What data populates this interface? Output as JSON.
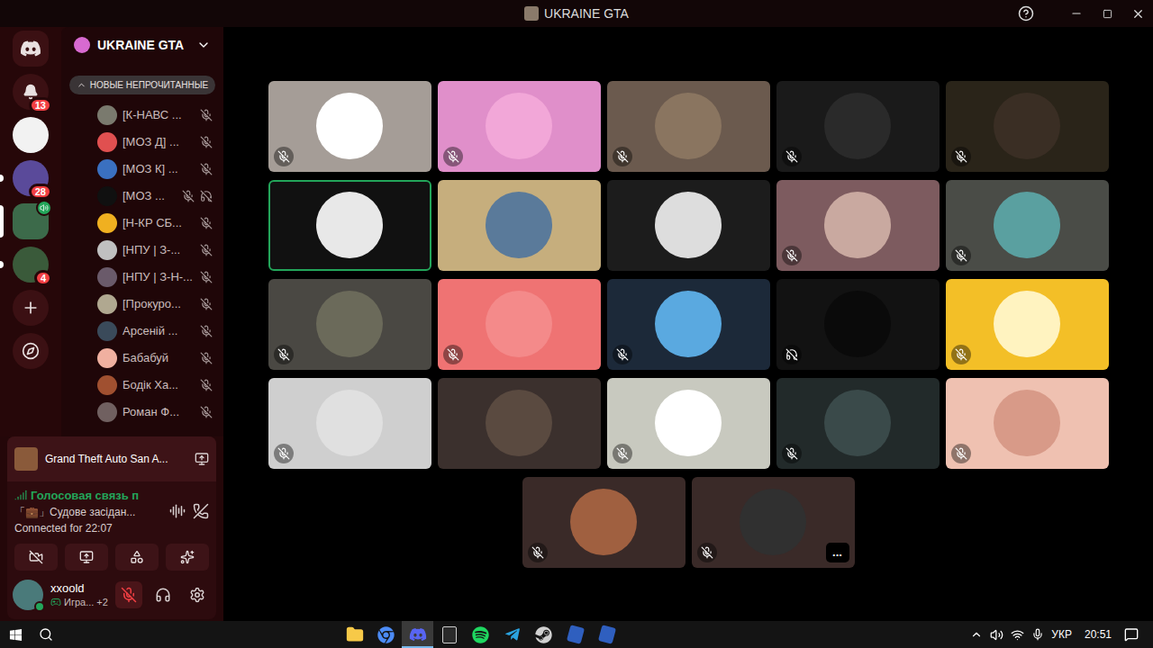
{
  "window": {
    "title": "UKRAINE GTA"
  },
  "server_rail": [
    {
      "kind": "home",
      "badge": null,
      "selected": false,
      "unread": false,
      "voice": false,
      "color": "#3b1013"
    },
    {
      "kind": "notifications",
      "badge": "13",
      "selected": false,
      "unread": false,
      "voice": false,
      "color": "#3b1013"
    },
    {
      "kind": "server",
      "badge": null,
      "selected": false,
      "unread": false,
      "voice": false,
      "color": "#f2f2f2"
    },
    {
      "kind": "server",
      "badge": "28",
      "selected": false,
      "unread": true,
      "voice": false,
      "color": "#5a4a9a"
    },
    {
      "kind": "server",
      "badge": null,
      "selected": true,
      "unread": false,
      "voice": true,
      "color": "#3c6a4a"
    },
    {
      "kind": "server",
      "badge": "4",
      "selected": false,
      "unread": true,
      "voice": false,
      "color": "#3a5a3a"
    },
    {
      "kind": "add",
      "badge": null,
      "selected": false,
      "unread": false,
      "voice": false,
      "color": "#3b1013"
    },
    {
      "kind": "discover",
      "badge": null,
      "selected": false,
      "unread": false,
      "voice": false,
      "color": "#3b1013"
    }
  ],
  "sidebar": {
    "server_name": "UKRAINE GTA",
    "unread_pill": "НОВЫЕ НЕПРОЧИТАННЫЕ",
    "members": [
      {
        "name": "[К-НАВС ...",
        "muted": true,
        "deafened": false,
        "avatar_color": "#7a7a6e"
      },
      {
        "name": "[МОЗ Д] ...",
        "muted": true,
        "deafened": false,
        "avatar_color": "#e05050"
      },
      {
        "name": "[МОЗ К] ...",
        "muted": true,
        "deafened": false,
        "avatar_color": "#3a70c0"
      },
      {
        "name": "[МОЗ ...",
        "muted": true,
        "deafened": true,
        "avatar_color": "#101010"
      },
      {
        "name": "[Н-КР СБ...",
        "muted": true,
        "deafened": false,
        "avatar_color": "#f0b020"
      },
      {
        "name": "[НПУ | З-...",
        "muted": true,
        "deafened": false,
        "avatar_color": "#c0c0c0"
      },
      {
        "name": "[НПУ | З-Н-...",
        "muted": true,
        "deafened": false,
        "avatar_color": "#6a5a6a"
      },
      {
        "name": "[Прокуро...",
        "muted": true,
        "deafened": false,
        "avatar_color": "#b0a890"
      },
      {
        "name": "Арсеній ...",
        "muted": true,
        "deafened": false,
        "avatar_color": "#3a4a5a"
      },
      {
        "name": "Бабабуй",
        "muted": true,
        "deafened": false,
        "avatar_color": "#f0b0a0"
      },
      {
        "name": "Бодік Ха...",
        "muted": true,
        "deafened": false,
        "avatar_color": "#a05030"
      },
      {
        "name": "Роман Ф...",
        "muted": true,
        "deafened": false,
        "avatar_color": "#706060"
      }
    ]
  },
  "activity": {
    "game": "Grand Theft Auto San A..."
  },
  "voice": {
    "status": "Голосовая связь п",
    "channel": "「💼」Судове засідан...",
    "connected": "Connected for 22:07"
  },
  "user": {
    "name": "xxoold",
    "status": "Игра...",
    "extra": "+2",
    "mic_muted": true,
    "deafened": false,
    "online": true
  },
  "grid": {
    "more_button": "...",
    "tiles": [
      {
        "color": "#a59d97",
        "avatar_color": "#ffffff",
        "muted": true,
        "deafened": false,
        "speaking": false,
        "more": false
      },
      {
        "color": "#e08fca",
        "avatar_color": "#f2a7d8",
        "muted": true,
        "deafened": false,
        "speaking": false,
        "more": false
      },
      {
        "color": "#6b5a4e",
        "avatar_color": "#8a7560",
        "muted": true,
        "deafened": false,
        "speaking": false,
        "more": false
      },
      {
        "color": "#1a1a1a",
        "avatar_color": "#2a2a2a",
        "muted": true,
        "deafened": false,
        "speaking": false,
        "more": false
      },
      {
        "color": "#2a2419",
        "avatar_color": "#3a2e24",
        "muted": true,
        "deafened": false,
        "speaking": false,
        "more": false
      },
      {
        "color": "#111111",
        "avatar_color": "#e8e8e8",
        "muted": false,
        "deafened": false,
        "speaking": true,
        "more": false
      },
      {
        "color": "#c6ae7d",
        "avatar_color": "#5a7a9a",
        "muted": false,
        "deafened": false,
        "speaking": false,
        "more": false
      },
      {
        "color": "#1c1c1c",
        "avatar_color": "#dddddd",
        "muted": false,
        "deafened": false,
        "speaking": false,
        "more": false
      },
      {
        "color": "#7d5b5f",
        "avatar_color": "#c9a9a0",
        "muted": true,
        "deafened": false,
        "speaking": false,
        "more": false
      },
      {
        "color": "#4a4c47",
        "avatar_color": "#5aa0a0",
        "muted": true,
        "deafened": false,
        "speaking": false,
        "more": false
      },
      {
        "color": "#4a4843",
        "avatar_color": "#6b6a5a",
        "muted": true,
        "deafened": false,
        "speaking": false,
        "more": false
      },
      {
        "color": "#ef7373",
        "avatar_color": "#f48a8a",
        "muted": true,
        "deafened": false,
        "speaking": false,
        "more": false
      },
      {
        "color": "#1c2939",
        "avatar_color": "#5aa9e0",
        "muted": true,
        "deafened": false,
        "speaking": false,
        "more": false
      },
      {
        "color": "#121212",
        "avatar_color": "#0a0a0a",
        "muted": false,
        "deafened": true,
        "speaking": false,
        "more": false
      },
      {
        "color": "#f3bf27",
        "avatar_color": "#fff3c0",
        "muted": true,
        "deafened": false,
        "speaking": false,
        "more": false
      },
      {
        "color": "#cfcfcf",
        "avatar_color": "#e0e0e0",
        "muted": true,
        "deafened": false,
        "speaking": false,
        "more": false
      },
      {
        "color": "#3b302d",
        "avatar_color": "#5a4a40",
        "muted": false,
        "deafened": false,
        "speaking": false,
        "more": false
      },
      {
        "color": "#c8c9bf",
        "avatar_color": "#ffffff",
        "muted": true,
        "deafened": false,
        "speaking": false,
        "more": false
      },
      {
        "color": "#222a2a",
        "avatar_color": "#3a4a4a",
        "muted": true,
        "deafened": false,
        "speaking": false,
        "more": false
      },
      {
        "color": "#efc1b1",
        "avatar_color": "#d89a88",
        "muted": true,
        "deafened": false,
        "speaking": false,
        "more": false
      },
      {
        "color": "#3a2a28",
        "avatar_color": "#a06040",
        "muted": true,
        "deafened": false,
        "speaking": false,
        "more": false
      },
      {
        "color": "#3a2a28",
        "avatar_color": "#303030",
        "muted": true,
        "deafened": false,
        "speaking": false,
        "more": true
      }
    ]
  },
  "taskbar": {
    "apps": [
      {
        "kind": "explorer",
        "selected": false
      },
      {
        "kind": "chrome",
        "selected": false
      },
      {
        "kind": "discord",
        "selected": true
      },
      {
        "kind": "epic",
        "selected": false
      },
      {
        "kind": "spotify",
        "selected": false
      },
      {
        "kind": "telegram",
        "selected": false
      },
      {
        "kind": "steam",
        "selected": false
      },
      {
        "kind": "samp",
        "selected": false
      },
      {
        "kind": "samp",
        "selected": false
      }
    ],
    "language": "УКР",
    "time": "20:51"
  }
}
